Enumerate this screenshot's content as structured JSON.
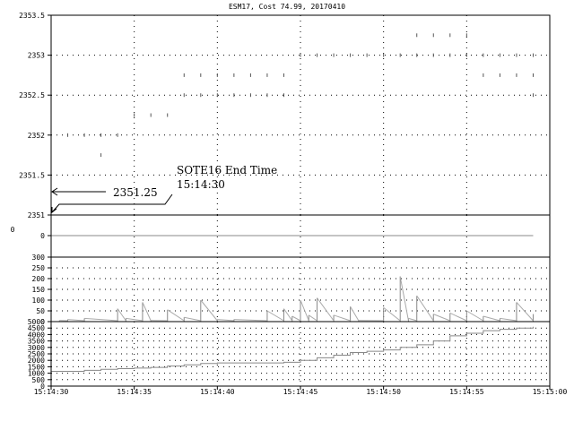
{
  "chart_data": [
    {
      "panel": "price",
      "type": "scatter",
      "title": "ESM17, Cost 74.99, 20170410",
      "xlim": [
        "15:14:30",
        "15:15:00"
      ],
      "ylim": [
        2351,
        2353.5
      ],
      "yticks": [
        "2351",
        "2351.5",
        "2352",
        "2352.5",
        "2353",
        "2353.5"
      ],
      "grid": true,
      "x": [
        "15:14:31",
        "15:14:32",
        "15:14:33",
        "15:14:33",
        "15:14:34",
        "15:14:35",
        "15:14:36",
        "15:14:37",
        "15:14:38",
        "15:14:38",
        "15:14:39",
        "15:14:39",
        "15:14:40",
        "15:14:40",
        "15:14:41",
        "15:14:41",
        "15:14:42",
        "15:14:42",
        "15:14:43",
        "15:14:43",
        "15:14:44",
        "15:14:44",
        "15:14:45",
        "15:14:46",
        "15:14:47",
        "15:14:48",
        "15:14:49",
        "15:14:50",
        "15:14:51",
        "15:14:52",
        "15:14:52",
        "15:14:53",
        "15:14:53",
        "15:14:54",
        "15:14:54",
        "15:14:55",
        "15:14:55",
        "15:14:56",
        "15:14:56",
        "15:14:57",
        "15:14:57",
        "15:14:58",
        "15:14:58",
        "15:14:59",
        "15:14:59",
        "15:14:59"
      ],
      "y": [
        2352,
        2352,
        2352,
        2351.75,
        2352,
        2352.25,
        2352.25,
        2352.25,
        2352.5,
        2352.75,
        2352.5,
        2352.75,
        2352.5,
        2352.75,
        2352.5,
        2352.75,
        2352.5,
        2352.75,
        2352.5,
        2352.75,
        2352.5,
        2352.75,
        2353,
        2353,
        2353,
        2353,
        2353,
        2353,
        2353,
        2353,
        2353.25,
        2353,
        2353.25,
        2353,
        2353.25,
        2353,
        2353.25,
        2353,
        2352.75,
        2353,
        2352.75,
        2353,
        2352.75,
        2353,
        2352.75,
        2352.5
      ],
      "annotations": [
        {
          "text": "SOTE16 End Time",
          "text2": "15:14:30",
          "label": "2351.25"
        }
      ]
    },
    {
      "panel": "zero-line",
      "type": "line",
      "ytick_left": "0",
      "ytick": "0",
      "x": [
        "15:14:30",
        "15:14:59"
      ],
      "y": [
        0,
        0
      ]
    },
    {
      "panel": "volume-spikes",
      "type": "line",
      "ylim": [
        0,
        300
      ],
      "yticks": [
        "300",
        "250",
        "200",
        "150",
        "100",
        "50",
        "0"
      ],
      "spikes": [
        {
          "x": "15:14:30.5",
          "y": 5
        },
        {
          "x": "15:14:31",
          "y": 10
        },
        {
          "x": "15:14:32",
          "y": 15
        },
        {
          "x": "15:14:34",
          "y": 60
        },
        {
          "x": "15:14:34.5",
          "y": 15
        },
        {
          "x": "15:14:35.5",
          "y": 90
        },
        {
          "x": "15:14:36",
          "y": 5
        },
        {
          "x": "15:14:37",
          "y": 55
        },
        {
          "x": "15:14:38",
          "y": 20
        },
        {
          "x": "15:14:39",
          "y": 100
        },
        {
          "x": "15:14:40",
          "y": 10
        },
        {
          "x": "15:14:41",
          "y": 10
        },
        {
          "x": "15:14:43",
          "y": 50
        },
        {
          "x": "15:14:44",
          "y": 60
        },
        {
          "x": "15:14:44.5",
          "y": 25
        },
        {
          "x": "15:14:45",
          "y": 100
        },
        {
          "x": "15:14:45.5",
          "y": 30
        },
        {
          "x": "15:14:46",
          "y": 110
        },
        {
          "x": "15:14:47",
          "y": 30
        },
        {
          "x": "15:14:48",
          "y": 70
        },
        {
          "x": "15:14:48.5",
          "y": 5
        },
        {
          "x": "15:14:50",
          "y": 65
        },
        {
          "x": "15:14:51",
          "y": 210
        },
        {
          "x": "15:14:51.5",
          "y": 15
        },
        {
          "x": "15:14:52",
          "y": 120
        },
        {
          "x": "15:14:53",
          "y": 35
        },
        {
          "x": "15:14:54",
          "y": 40
        },
        {
          "x": "15:14:55",
          "y": 50
        },
        {
          "x": "15:14:56",
          "y": 25
        },
        {
          "x": "15:14:57",
          "y": 15
        },
        {
          "x": "15:14:58",
          "y": 90
        },
        {
          "x": "15:14:59",
          "y": 35
        }
      ]
    },
    {
      "panel": "cumulative-volume",
      "type": "line",
      "ylim": [
        0,
        5000
      ],
      "yticks": [
        "5000",
        "4500",
        "4000",
        "3500",
        "3000",
        "2500",
        "2000",
        "1500",
        "1000",
        "500",
        "0"
      ],
      "xticks": [
        "15:14:30",
        "15:14:35",
        "15:14:40",
        "15:14:45",
        "15:14:50",
        "15:14:55",
        "15:15:00"
      ],
      "x": [
        "15:14:30",
        "15:14:31",
        "15:14:32",
        "15:14:33",
        "15:14:34",
        "15:14:35",
        "15:14:36",
        "15:14:37",
        "15:14:38",
        "15:14:39",
        "15:14:40",
        "15:14:41",
        "15:14:42",
        "15:14:43",
        "15:14:44",
        "15:14:45",
        "15:14:46",
        "15:14:47",
        "15:14:48",
        "15:14:49",
        "15:14:50",
        "15:14:51",
        "15:14:52",
        "15:14:53",
        "15:14:54",
        "15:14:55",
        "15:14:56",
        "15:14:57",
        "15:14:58",
        "15:14:59"
      ],
      "y": [
        1150,
        1150,
        1220,
        1300,
        1350,
        1400,
        1450,
        1550,
        1650,
        1750,
        1800,
        1800,
        1800,
        1800,
        1850,
        2000,
        2200,
        2400,
        2600,
        2700,
        2800,
        3000,
        3200,
        3500,
        3900,
        4100,
        4300,
        4400,
        4500,
        4600
      ]
    }
  ]
}
